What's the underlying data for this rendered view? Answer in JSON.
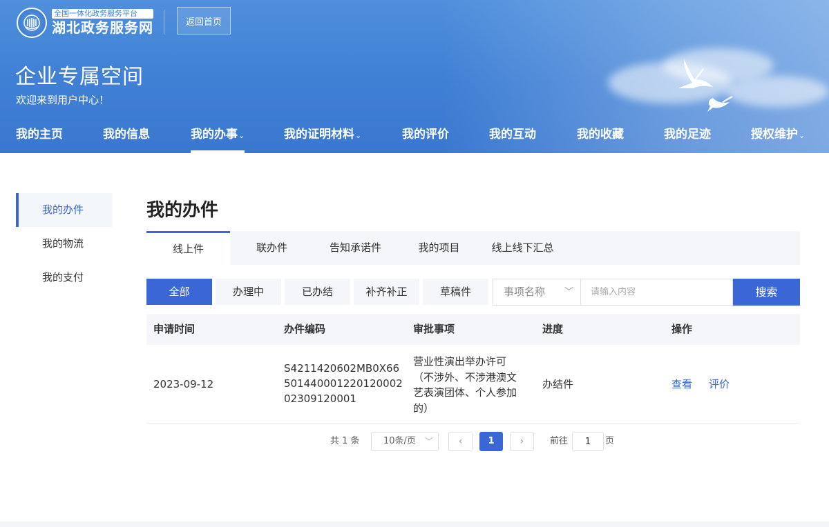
{
  "header": {
    "logo": {
      "platform_label": "全国一体化政务服务平台",
      "site_name": "湖北政务服务网"
    },
    "home_button": "返回首页",
    "space_title": "企业专属空间",
    "welcome": "欢迎来到用户中心！"
  },
  "nav": {
    "items": [
      {
        "label": "我的主页"
      },
      {
        "label": "我的信息"
      },
      {
        "label": "我的办事",
        "chevron": "⌄"
      },
      {
        "label": "我的证明材料",
        "chevron": "⌄"
      },
      {
        "label": "我的评价"
      },
      {
        "label": "我的互动"
      },
      {
        "label": "我的收藏"
      },
      {
        "label": "我的足迹"
      },
      {
        "label": "授权维护",
        "chevron": "⌄"
      }
    ],
    "active": "我的办事"
  },
  "sidebar": {
    "items": [
      {
        "label": "我的办件"
      },
      {
        "label": "我的物流"
      },
      {
        "label": "我的支付"
      }
    ],
    "active": "我的办件"
  },
  "main": {
    "title": "我的办件",
    "tabs": [
      {
        "label": "线上件"
      },
      {
        "label": "联办件"
      },
      {
        "label": "告知承诺件"
      },
      {
        "label": "我的项目"
      },
      {
        "label": "线上线下汇总"
      }
    ],
    "active_tab": "线上件",
    "filters": [
      {
        "label": "全部"
      },
      {
        "label": "办理中"
      },
      {
        "label": "已办结"
      },
      {
        "label": "补齐补正"
      },
      {
        "label": "草稿件"
      }
    ],
    "active_filter": "全部",
    "search": {
      "select_value": "事项名称",
      "placeholder": "请输入内容",
      "value": "",
      "button": "搜索"
    },
    "table": {
      "columns": [
        "申请时间",
        "办件编码",
        "审批事项",
        "进度",
        "操作"
      ],
      "rows": [
        {
          "date": "2023-09-12",
          "code": "S4211420602MB0X6650144000122012000202309120001",
          "matter": "营业性演出举办许可（不涉外、不涉港澳文艺表演团体、个人参加的）",
          "progress": "办结件",
          "actions": [
            "查看",
            "评价"
          ]
        }
      ]
    },
    "pagination": {
      "total_text": "共 1 条",
      "page_size": "10条/页",
      "prev": "‹",
      "current_page": "1",
      "next": "›",
      "goto_label": "前往",
      "goto_value": "1",
      "page_suffix": "页"
    }
  },
  "colors": {
    "primary": "#3a66d6",
    "banner": "#3f7fd4",
    "table_header_bg": "#f4f6fa"
  },
  "icons": {
    "logo": "emblem-icon",
    "select_arrow": "chevron-down-icon",
    "decoration": "crane-birds-icon"
  }
}
